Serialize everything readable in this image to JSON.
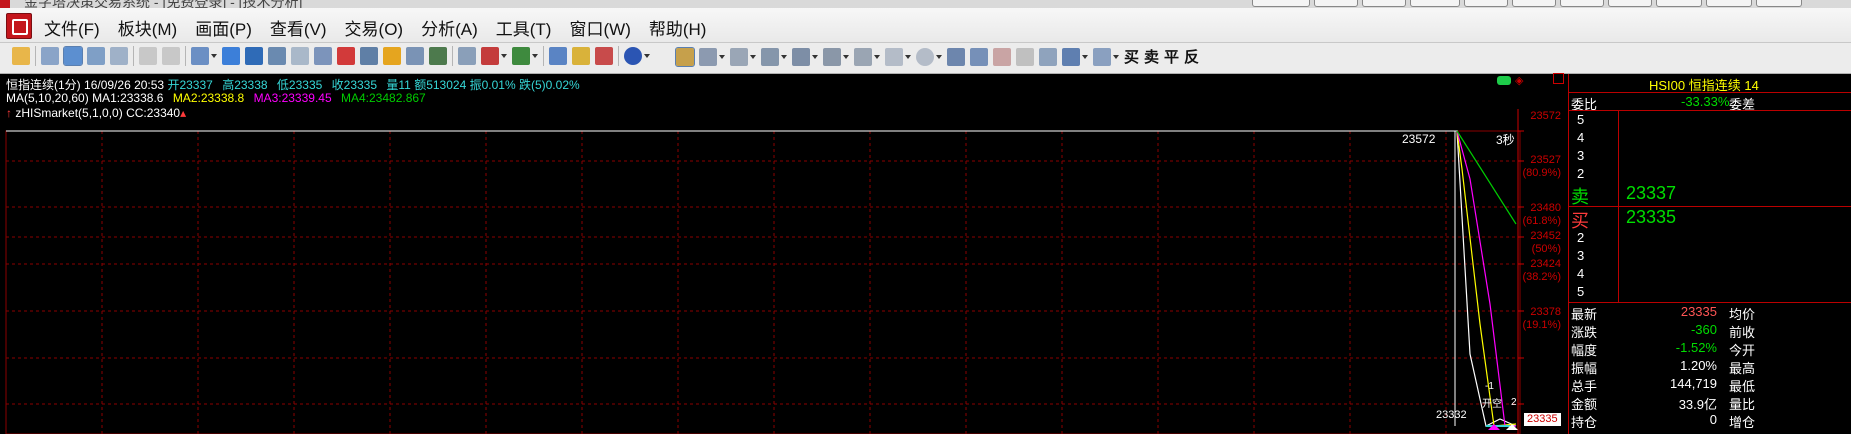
{
  "titlebar": {
    "title": "金字塔决策交易系统 - [免费登录] - [技术分析]"
  },
  "menu": {
    "items": [
      "文件(F)",
      "板块(M)",
      "画面(P)",
      "查看(V)",
      "交易(O)",
      "分析(A)",
      "工具(T)",
      "窗口(W)",
      "帮助(H)"
    ]
  },
  "toolbar": {
    "order_buy": "买",
    "order_sell": "卖",
    "order_flat": "平",
    "order_reverse": "反"
  },
  "chart": {
    "header_name": "恒指连续",
    "header_period": "(1分)",
    "header_datetime": "16/09/26 20:53",
    "header_open": "开23337",
    "header_high": "高23338",
    "header_low": "低23335",
    "header_close": "收23335",
    "header_vol": "量11",
    "header_amount": "额513024",
    "header_amp": "振0.01%",
    "header_change": "跌(5)0.02%",
    "ma_params": "MA(5,10,20,60)",
    "ma1": "MA1:23338.6",
    "ma2": "MA2:23338.8",
    "ma3": "MA3:23339.45",
    "ma4": "MA4:23482.867",
    "indicator": "zHISmarket(5,1,0,0)",
    "cc": "CC:23340",
    "high_label": "23572",
    "low_label": "23332",
    "seconds_label": "3秒",
    "annot_minus1": "-1",
    "annot_kaikong": "开空",
    "annot_2": "2",
    "current_price_tag": "23335",
    "axis": [
      {
        "value": "23572",
        "pct": ""
      },
      {
        "value": "23527",
        "pct": "(80.9%)"
      },
      {
        "value": "23480",
        "pct": "(61.8%)"
      },
      {
        "value": "23452",
        "pct": "(50%)"
      },
      {
        "value": "23424",
        "pct": "(38.2%)"
      },
      {
        "value": "23378",
        "pct": "(19.1%)"
      }
    ],
    "colors": {
      "up": "#ff3b3b",
      "down": "#36d7d7",
      "grid": "#8b0000",
      "ma1": "#ffffff",
      "ma2": "#ffff00",
      "ma3": "#ff00ff",
      "ma4": "#00cc00"
    }
  },
  "quote": {
    "code": "HSI00",
    "name": "恒指连续",
    "count": "14",
    "weibi_label": "委比",
    "weibi_value": "-33.33%",
    "weicha_label": "委差",
    "ask_levels": [
      "5",
      "4",
      "3",
      "2"
    ],
    "sell_label": "卖",
    "sell_price": "23337",
    "buy_label": "买",
    "buy_price": "23335",
    "bid_levels": [
      "2",
      "3",
      "4",
      "5"
    ],
    "stats": [
      {
        "label": "最新",
        "value": "23335",
        "label2": "均价",
        "color": "#ff5555"
      },
      {
        "label": "涨跌",
        "value": "-360",
        "label2": "前收",
        "color": "#00dd00"
      },
      {
        "label": "幅度",
        "value": "-1.52%",
        "label2": "今开",
        "color": "#00dd00"
      },
      {
        "label": "振幅",
        "value": "1.20%",
        "label2": "最高",
        "color": "#ffffff"
      },
      {
        "label": "总手",
        "value": "144,719",
        "label2": "最低",
        "color": "#ffffff"
      },
      {
        "label": "金额",
        "value": "33.9亿",
        "label2": "量比",
        "color": "#ffffff"
      },
      {
        "label": "持仓",
        "value": "0",
        "label2": "增仓",
        "color": "#ffffff"
      }
    ]
  }
}
